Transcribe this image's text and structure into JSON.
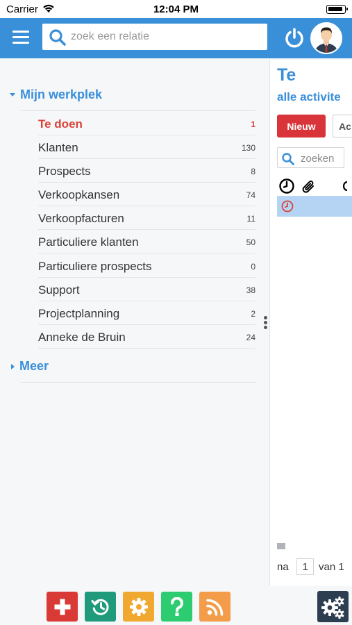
{
  "status_bar": {
    "carrier": "Carrier",
    "time": "12:04 PM"
  },
  "header": {
    "search_placeholder": "zoek een relatie"
  },
  "sidebar": {
    "section_title": "Mijn werkplek",
    "items": [
      {
        "label": "Te doen",
        "count": "1",
        "active": true
      },
      {
        "label": "Klanten",
        "count": "130"
      },
      {
        "label": "Prospects",
        "count": "8"
      },
      {
        "label": "Verkoopkansen",
        "count": "74"
      },
      {
        "label": "Verkoopfacturen",
        "count": "11"
      },
      {
        "label": "Particuliere klanten",
        "count": "50"
      },
      {
        "label": "Particuliere prospects",
        "count": "0"
      },
      {
        "label": "Support",
        "count": "38"
      },
      {
        "label": "Projectplanning",
        "count": "2"
      },
      {
        "label": "Anneke de Bruin",
        "count": "24"
      }
    ],
    "more_label": "Meer"
  },
  "detail": {
    "title": "Te",
    "subtitle": "alle activite",
    "new_button": "Nieuw",
    "second_button": "Ac",
    "search_placeholder": "zoeken",
    "pager": {
      "prefix": "na",
      "page": "1",
      "suffix": "van 1"
    }
  },
  "colors": {
    "brand_blue": "#3a8fd9",
    "active_red": "#d9443a",
    "new_button": "#d9343a",
    "selected_row": "#b5d4f4"
  },
  "icons": {
    "menu": "hamburger-menu-icon",
    "search": "search-icon",
    "power": "power-icon",
    "clock": "clock-icon",
    "attachment": "paperclip-icon",
    "add": "plus-icon",
    "history": "history-icon",
    "settings": "gear-icon",
    "help": "question-icon",
    "rss": "rss-icon",
    "config": "gears-icon"
  }
}
